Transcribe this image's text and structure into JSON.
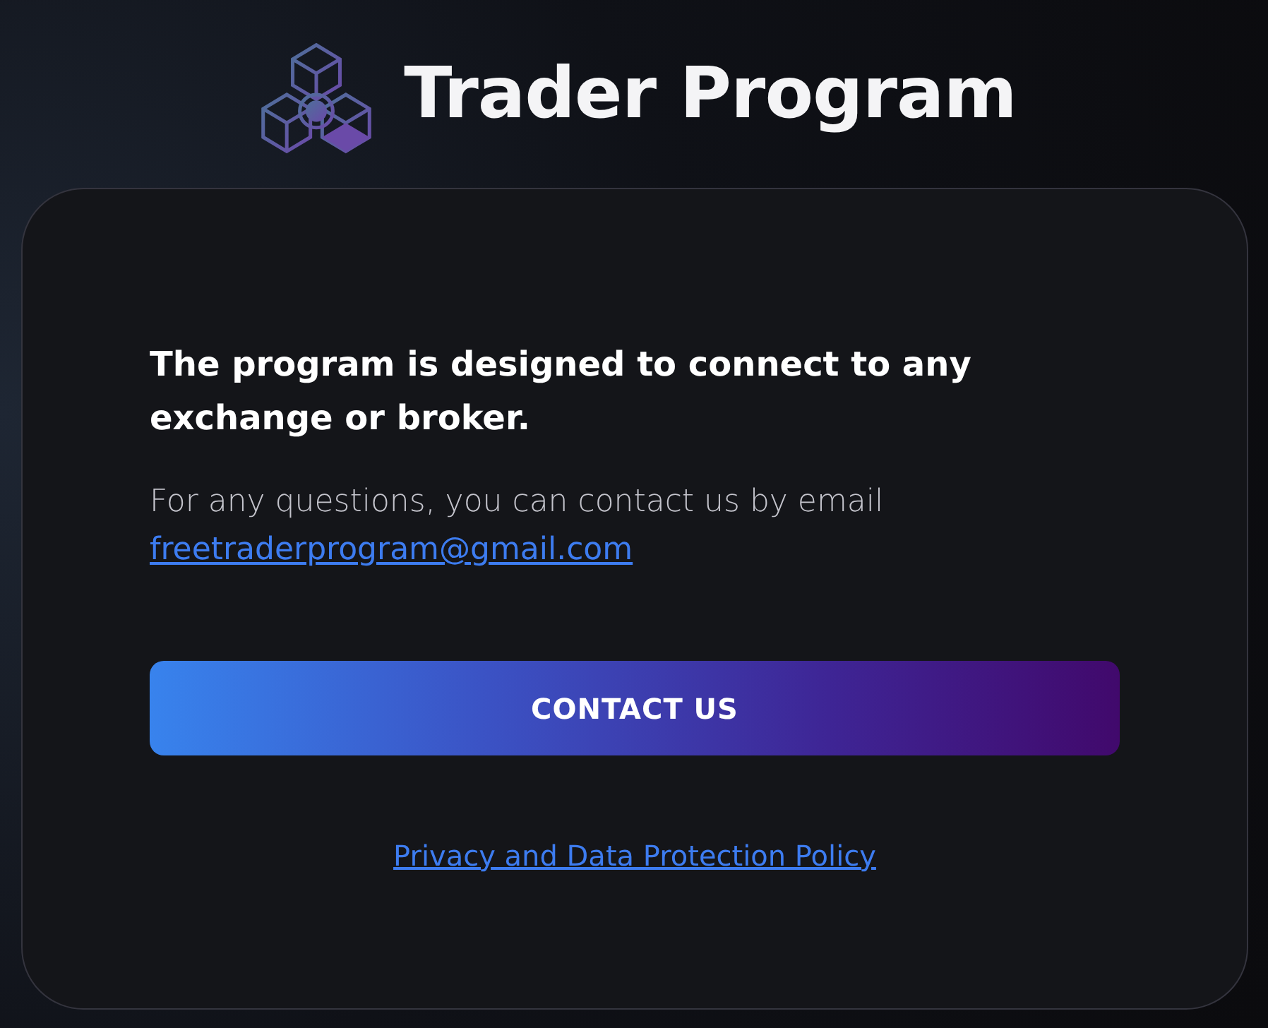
{
  "brand": {
    "title": "Trader Program"
  },
  "card": {
    "heading": "The program is designed to connect to any exchange or broker.",
    "contact_text": "For any questions, you can contact us by email",
    "email": "freetraderprogram@gmail.com",
    "button": "CONTACT US",
    "policy_link": "Privacy and Data Protection Policy"
  }
}
